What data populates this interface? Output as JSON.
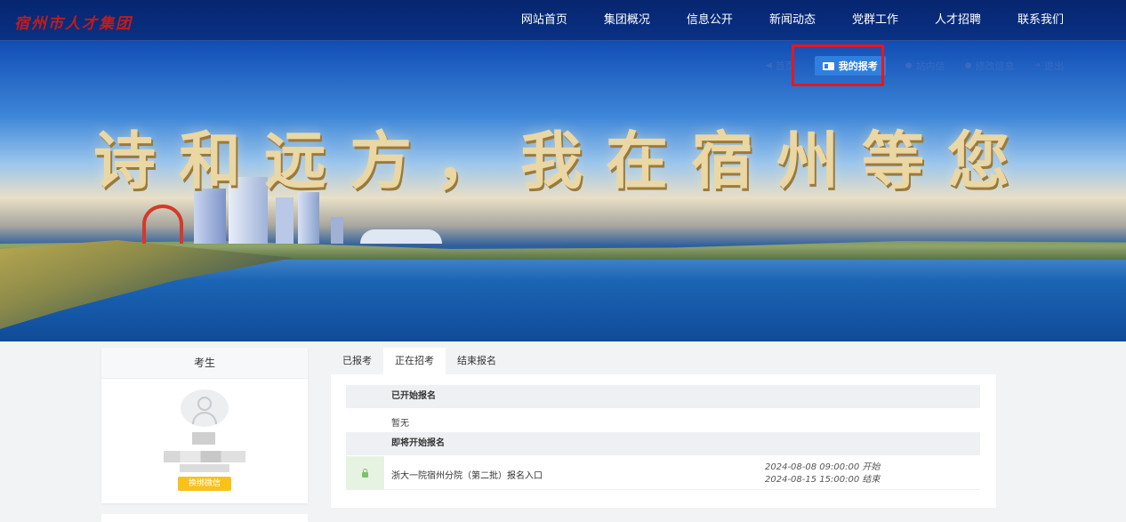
{
  "header": {
    "logo": "宿州市人才集团",
    "nav": [
      "网站首页",
      "集团概况",
      "信息公开",
      "新闻动态",
      "党群工作",
      "人才招聘",
      "联系我们"
    ]
  },
  "userbar": {
    "home": "首页",
    "my_exams": "我的报考",
    "messages": "站内信",
    "edit_info": "修改信息",
    "logout": "退出"
  },
  "banner": {
    "slogan": "诗和远方，我在宿州等您"
  },
  "profile": {
    "title": "考生",
    "wechat_button": "换绑微信"
  },
  "tabs": [
    "已报考",
    "正在招考",
    "结束报名"
  ],
  "active_tab": "正在招考",
  "panel": {
    "section_started": "已开始报名",
    "none_text": "暂无",
    "section_upcoming": "即将开始报名",
    "job": {
      "title": "浙大一院宿州分院（第二批）报名入口",
      "start": "2024-08-08 09:00:00 开始",
      "end": "2024-08-15 15:00:00 结束"
    }
  },
  "colors": {
    "nav_bg": "#0a3185",
    "primary": "#2f7fe0",
    "highlight_border": "#e8161d",
    "wechat_button": "#f8c21a"
  }
}
